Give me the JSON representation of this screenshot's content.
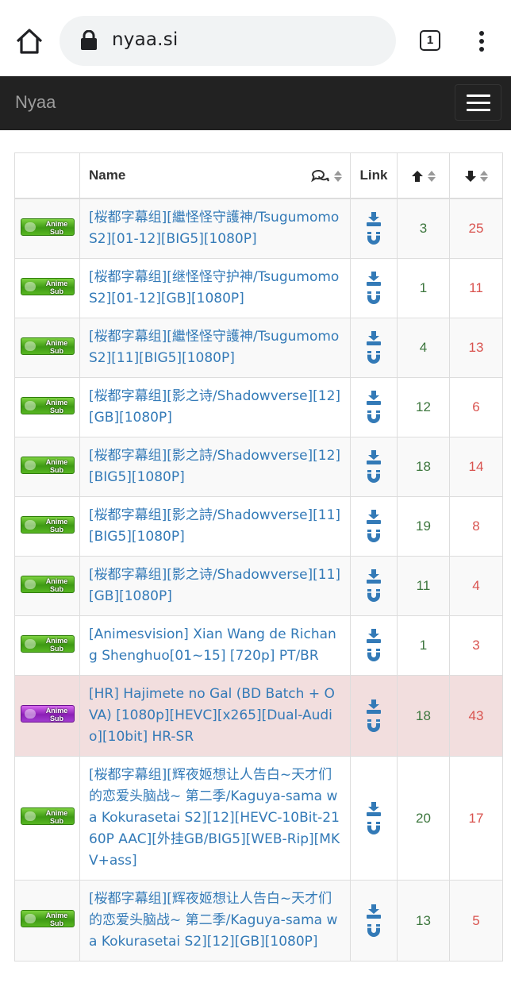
{
  "browser": {
    "url": "nyaa.si",
    "tab_count": "1"
  },
  "navbar": {
    "brand": "Nyaa"
  },
  "table": {
    "headers": {
      "name": "Name",
      "link": "Link"
    },
    "rows": [
      {
        "name": "[桜都字幕组][繼怪怪守護神/Tsugumomo S2][01-12][BIG5][1080P]",
        "seeders": "3",
        "leechers": "25",
        "category": "Anime - Sub",
        "style": "default"
      },
      {
        "name": "[桜都字幕组][继怪怪守护神/Tsugumomo S2][01-12][GB][1080P]",
        "seeders": "1",
        "leechers": "11",
        "category": "Anime - Sub",
        "style": "default"
      },
      {
        "name": "[桜都字幕组][繼怪怪守護神/Tsugumomo S2][11][BIG5][1080P]",
        "seeders": "4",
        "leechers": "13",
        "category": "Anime - Sub",
        "style": "default"
      },
      {
        "name": "[桜都字幕组][影之诗/Shadowverse][12][GB][1080P]",
        "seeders": "12",
        "leechers": "6",
        "category": "Anime - Sub",
        "style": "default"
      },
      {
        "name": "[桜都字幕组][影之詩/Shadowverse][12][BIG5][1080P]",
        "seeders": "18",
        "leechers": "14",
        "category": "Anime - Sub",
        "style": "default"
      },
      {
        "name": "[桜都字幕组][影之詩/Shadowverse][11][BIG5][1080P]",
        "seeders": "19",
        "leechers": "8",
        "category": "Anime - Sub",
        "style": "default"
      },
      {
        "name": "[桜都字幕组][影之诗/Shadowverse][11][GB][1080P]",
        "seeders": "11",
        "leechers": "4",
        "category": "Anime - Sub",
        "style": "default"
      },
      {
        "name": "[Animesvision] Xian Wang de Richang Shenghuo[01~15] [720p] PT/BR",
        "seeders": "1",
        "leechers": "3",
        "category": "Anime - Sub",
        "style": "default"
      },
      {
        "name": "[HR] Hajimete no Gal (BD Batch + OVA) [1080p][HEVC][x265][Dual-Audio][10bit] HR-SR",
        "seeders": "18",
        "leechers": "43",
        "category": "Anime - Raw",
        "style": "danger"
      },
      {
        "name": "[桜都字幕组][辉夜姬想让人告白~天才们的恋爱头脑战~ 第二季/Kaguya-sama wa Kokurasetai S2][12][HEVC-10Bit-2160P AAC][外挂GB/BIG5][WEB-Rip][MKV+ass]",
        "seeders": "20",
        "leechers": "17",
        "category": "Anime - Sub",
        "style": "default"
      },
      {
        "name": "[桜都字幕组][辉夜姬想让人告白~天才们的恋爱头脑战~ 第二季/Kaguya-sama wa Kokurasetai S2][12][GB][1080P]",
        "seeders": "13",
        "leechers": "5",
        "category": "Anime - Sub",
        "style": "default"
      }
    ]
  },
  "colors": {
    "navbar_bg": "#222222",
    "link": "#337ab7",
    "seeders": "#3c763d",
    "leechers": "#d9534f",
    "danger_row": "#f2dede"
  },
  "icons": {
    "category_badge_text": "Anime Sub"
  }
}
